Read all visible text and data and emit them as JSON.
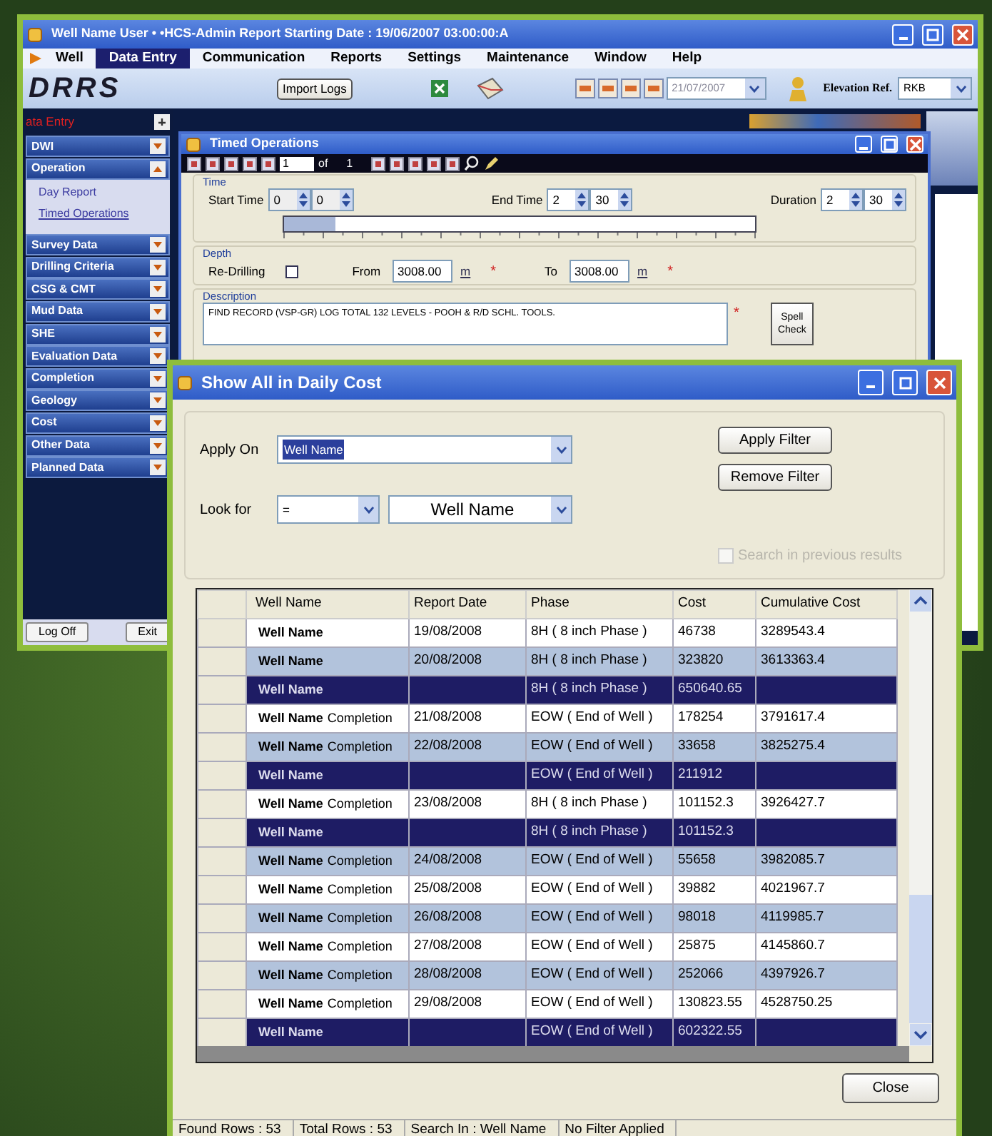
{
  "main_window": {
    "title": "Well Name  User • •HCS-Admin    Report Starting Date : 19/06/2007 03:00:00:A",
    "menu": [
      {
        "label": "Well",
        "selected": false
      },
      {
        "label": "Data Entry",
        "selected": true
      },
      {
        "label": "Communication",
        "selected": false
      },
      {
        "label": "Reports",
        "selected": false
      },
      {
        "label": "Settings",
        "selected": false
      },
      {
        "label": "Maintenance",
        "selected": false
      },
      {
        "label": "Window",
        "selected": false
      },
      {
        "label": "Help",
        "selected": false
      }
    ],
    "toolbar": {
      "logo": "DRRS",
      "import_button": "Import Logs",
      "date": "21/07/2007",
      "elevation_label": "Elevation Ref.",
      "elevation_value": "RKB"
    },
    "sidebar": {
      "title": "ata Entry",
      "groups": [
        {
          "label": "DWI",
          "expanded": false
        },
        {
          "label": "Operation",
          "expanded": true,
          "children": [
            {
              "label": "Day Report",
              "selected": false
            },
            {
              "label": "Timed Operations",
              "selected": true
            }
          ]
        },
        {
          "label": "Survey Data",
          "expanded": false
        },
        {
          "label": "Drilling Criteria",
          "expanded": false
        },
        {
          "label": "CSG & CMT",
          "expanded": false
        },
        {
          "label": "Mud Data",
          "expanded": false
        },
        {
          "label": "SHE",
          "expanded": false
        },
        {
          "label": "Evaluation Data",
          "expanded": false
        },
        {
          "label": "Completion",
          "expanded": false
        },
        {
          "label": "Geology",
          "expanded": false
        },
        {
          "label": "Cost",
          "expanded": false
        },
        {
          "label": "Other Data",
          "expanded": false
        },
        {
          "label": "Planned Data",
          "expanded": false
        }
      ],
      "buttons": [
        "Log Off",
        "Exit"
      ]
    }
  },
  "timed_operations": {
    "title": "Timed Operations",
    "record": "1",
    "record_of": "of",
    "record_total": "1",
    "time": {
      "legend": "Time",
      "start_label": "Start Time",
      "start_hours": "0",
      "start_minutes": "0",
      "end_label": "End Time",
      "end_hours": "2",
      "end_minutes": "30",
      "duration_label": "Duration",
      "duration_hours": "2",
      "duration_minutes": "30",
      "level": 0.11
    },
    "depth": {
      "legend": "Depth",
      "redrilling_label": "Re-Drilling",
      "redrilling_checked": false,
      "from_label": "From",
      "from_value": "3008.00",
      "from_unit": "m",
      "from_required": "*",
      "to_label": "To",
      "to_value": "3008.00",
      "to_unit": "m",
      "to_required": "*"
    },
    "description": {
      "legend": "Description",
      "text": "FIND RECORD (VSP-GR) LOG TOTAL 132 LEVELS - POOH & R/D SCHL. TOOLS.",
      "required": "*",
      "spell_button": "Spell Check"
    }
  },
  "daily_cost_dialog": {
    "title": "Show All in Daily Cost",
    "apply_on_label": "Apply On",
    "apply_on_value": "Well Name",
    "apply_on_highlighted": true,
    "look_for_label": "Look for",
    "operator_value": "=",
    "look_for_value": "Well Name",
    "buttons": [
      "Apply Filter",
      "Remove Filter"
    ],
    "search_previous": {
      "label": "Search in previous results",
      "checked": false,
      "disabled": true
    },
    "table": {
      "columns": [
        "Well Name",
        "Report Date",
        "Phase",
        "Cost",
        "Cumulative Cost"
      ],
      "rows": [
        {
          "kind": "plain",
          "well": "Well Name",
          "date": "19/08/2008",
          "phase": "8H ( 8 inch Phase )",
          "cost": "46738",
          "cumulative": "3289543.4"
        },
        {
          "kind": "alt",
          "well": "Well Name",
          "date": "20/08/2008",
          "phase": "8H ( 8 inch Phase )",
          "cost": "323820",
          "cumulative": "3613363.4"
        },
        {
          "kind": "total",
          "well": "Well Name",
          "phase": "8H ( 8 inch Phase )",
          "cost": "650640.65"
        },
        {
          "kind": "plain",
          "well": "Well Name",
          "extra": "Completion",
          "date": "21/08/2008",
          "phase": "EOW ( End of Well )",
          "cost": "178254",
          "cumulative": "3791617.4"
        },
        {
          "kind": "alt",
          "well": "Well Name",
          "extra": "Completion",
          "date": "22/08/2008",
          "phase": "EOW ( End of Well )",
          "cost": "33658",
          "cumulative": "3825275.4"
        },
        {
          "kind": "total",
          "well": "Well Name",
          "phase": "EOW ( End of Well )",
          "cost": "211912"
        },
        {
          "kind": "plain",
          "well": "Well Name",
          "extra": "Completion",
          "date": "23/08/2008",
          "phase": "8H ( 8 inch Phase )",
          "cost": "101152.3",
          "cumulative": "3926427.7"
        },
        {
          "kind": "total",
          "well": "Well Name",
          "phase": "8H ( 8 inch Phase )",
          "cost": "101152.3"
        },
        {
          "kind": "alt",
          "well": "Well Name",
          "extra": "Completion",
          "date": "24/08/2008",
          "phase": "EOW ( End of Well )",
          "cost": "55658",
          "cumulative": "3982085.7"
        },
        {
          "kind": "plain",
          "well": "Well Name",
          "extra": "Completion",
          "date": "25/08/2008",
          "phase": "EOW ( End of Well )",
          "cost": "39882",
          "cumulative": "4021967.7"
        },
        {
          "kind": "alt",
          "well": "Well Name",
          "extra": "Completion",
          "date": "26/08/2008",
          "phase": "EOW ( End of Well )",
          "cost": "98018",
          "cumulative": "4119985.7"
        },
        {
          "kind": "plain",
          "well": "Well Name",
          "extra": "Completion",
          "date": "27/08/2008",
          "phase": "EOW ( End of Well )",
          "cost": "25875",
          "cumulative": "4145860.7"
        },
        {
          "kind": "alt",
          "well": "Well Name",
          "extra": "Completion",
          "date": "28/08/2008",
          "phase": "EOW ( End of Well )",
          "cost": "252066",
          "cumulative": "4397926.7"
        },
        {
          "kind": "plain",
          "well": "Well Name",
          "extra": "Completion",
          "date": "29/08/2008",
          "phase": "EOW ( End of Well )",
          "cost": "130823.55",
          "cumulative": "4528750.25"
        },
        {
          "kind": "total",
          "well": "Well Name",
          "phase": "EOW ( End of Well )",
          "cost": "602322.55"
        }
      ]
    },
    "close_button": "Close",
    "status_bar": [
      "Found Rows : 53",
      "Total Rows : 53",
      "Search In : Well Name",
      "No Filter Applied"
    ]
  }
}
